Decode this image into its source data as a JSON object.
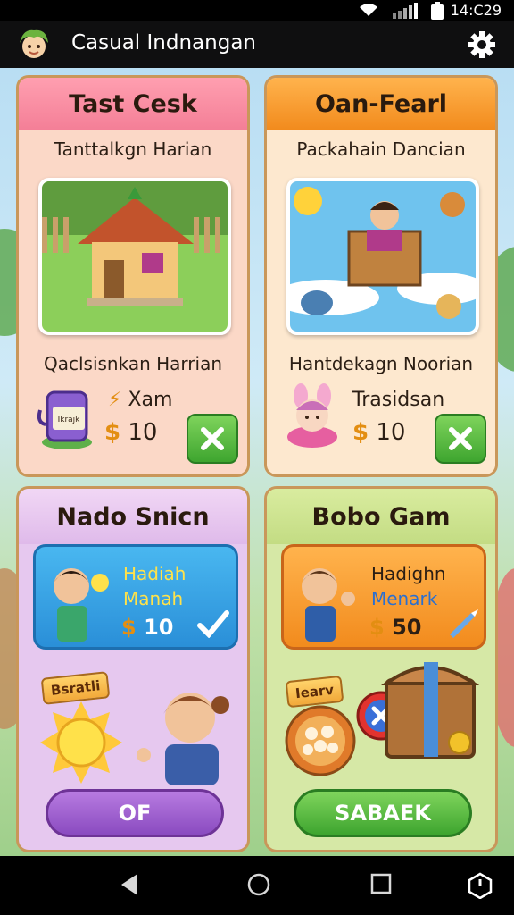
{
  "status": {
    "time": "14:C29"
  },
  "app": {
    "title": "Casual  Indnangan"
  },
  "cards": [
    {
      "header": "Tast Cesk",
      "subtitle": "Tanttalkgn Harian",
      "label": "Qaclsisnkan Harrian",
      "reward_label": "Xam",
      "amount_symbol": "$",
      "amount": "10",
      "jar_text": "Ikrajk"
    },
    {
      "header": "Oan-Fearl",
      "subtitle": "Packahain Dancian",
      "label": "Hantdekagn Noorian",
      "reward_label": "Trasidsan",
      "amount_symbol": "$",
      "amount": "10"
    },
    {
      "header": "Nado Snicn",
      "banner_line1": "Hadiah",
      "banner_line2": "Manah",
      "amount_symbol": "$",
      "amount": "10",
      "tag": "Bsratli",
      "button": "OF"
    },
    {
      "header": "Bobo Gam",
      "banner_line1": "Hadighn",
      "banner_line2": "Menark",
      "amount_symbol": "$",
      "amount": "50",
      "tag": "Iearv",
      "button": "SABAEK"
    }
  ],
  "colors": {
    "accent_green": "#3ea52f",
    "accent_purple": "#8a4bc0",
    "coin": "#e38e12"
  },
  "icons": [
    "wifi-icon",
    "signal-icon",
    "battery-icon",
    "gear-icon",
    "close-icon",
    "check-icon",
    "back-icon",
    "home-icon",
    "recents-icon",
    "power-icon"
  ]
}
